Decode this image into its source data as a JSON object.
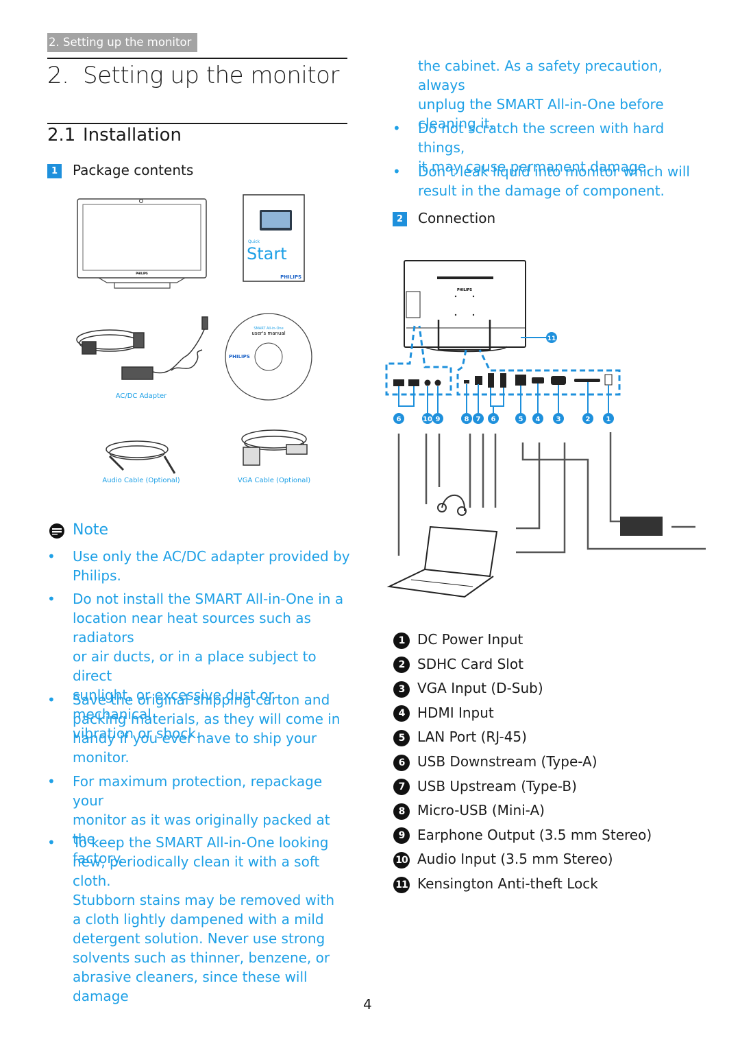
{
  "header": {
    "tab_label": "2. Setting up the monitor",
    "chapter_number": "2.",
    "chapter_title": "Setting up the monitor",
    "section_number": "2.1",
    "section_title": "Installation"
  },
  "package_contents": {
    "step": "1",
    "title": "Package contents",
    "items": {
      "monitor_brand": "PHILIPS",
      "quick_start_small": "Quick",
      "quick_start_big": "Start",
      "quick_start_brand": "PHILIPS",
      "adapter_caption": "AC/DC Adapter",
      "cd_line1": "SMART All-in-One",
      "cd_line2": "user's manual",
      "cd_brand": "PHILIPS",
      "audio_caption": "Audio Cable (Optional)",
      "vga_caption": "VGA Cable (Optional)"
    }
  },
  "note": {
    "title": "Note",
    "bullets": [
      "Use only the AC/DC adapter provided by\nPhilips.",
      "Do not install the SMART All-in-One in a\nlocation near heat sources such as radiators\nor air ducts, or in a place subject to direct\nsunlight, or excessive dust or mechanical\nvibration or shock.",
      "Save the original shipping carton and\npacking materials, as they will come in\nhandy if you ever have to ship your\nmonitor.",
      "For maximum protection, repackage your\nmonitor as it was originally packed at the\nfactory.",
      "To keep the SMART All-in-One looking\nnew, periodically clean it with a soft cloth.\nStubborn stains may be removed with\na cloth lightly dampened with a mild\ndetergent solution. Never use strong\nsolvents such as thinner, benzene, or\nabrasive cleaners, since these will damage"
    ]
  },
  "right_column": {
    "continued_text": "the cabinet. As a safety precaution, always\nunplug the SMART All-in-One before\ncleaning it.",
    "bullets": [
      "Do not scratch the screen with hard things,\nit may cause permanent damage.",
      "Don’t leak liquid into monitor which will\nresult in the damage of component."
    ]
  },
  "connection": {
    "step": "2",
    "title": "Connection",
    "diagram_brand": "PHILIPS",
    "diagram_labels_left": [
      "6",
      "10",
      "9"
    ],
    "diagram_labels_right": [
      "8",
      "7",
      "6",
      "5",
      "4",
      "3",
      "2",
      "1"
    ],
    "diagram_label_lock": "11",
    "legend": [
      {
        "num": "1",
        "label": "DC Power Input"
      },
      {
        "num": "2",
        "label": "SDHC Card Slot"
      },
      {
        "num": "3",
        "label": "VGA Input (D-Sub)"
      },
      {
        "num": "4",
        "label": "HDMI Input"
      },
      {
        "num": "5",
        "label": "LAN Port (RJ-45)"
      },
      {
        "num": "6",
        "label": "USB Downstream (Type-A)"
      },
      {
        "num": "7",
        "label": "USB Upstream (Type-B)"
      },
      {
        "num": "8",
        "label": "Micro-USB (Mini-A)"
      },
      {
        "num": "9",
        "label": "Earphone Output (3.5 mm Stereo)"
      },
      {
        "num": "10",
        "label": "Audio Input (3.5 mm Stereo)"
      },
      {
        "num": "11",
        "label": "Kensington Anti-theft Lock"
      }
    ]
  },
  "colors": {
    "accent_blue": "#1ea0e6",
    "badge_blue": "#1e90dc",
    "tab_gray": "#a3a3a3"
  },
  "footer": {
    "page_number": "4"
  }
}
